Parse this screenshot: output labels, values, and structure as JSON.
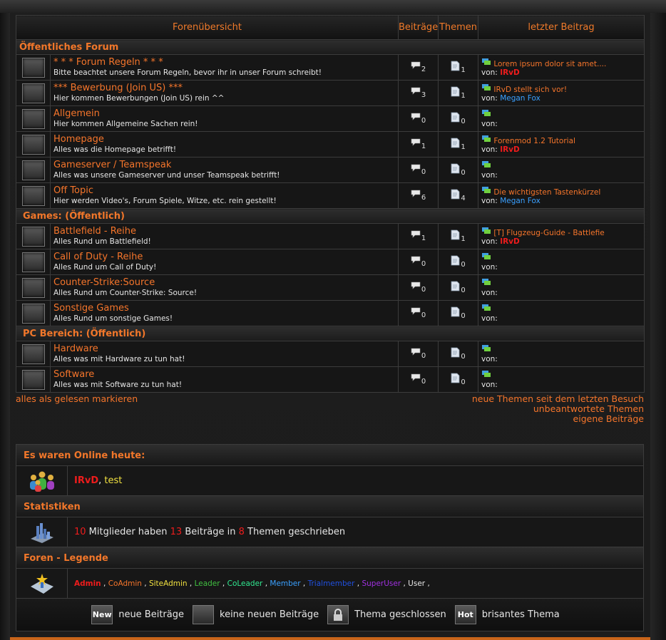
{
  "header": {
    "col_forum": "Forenübersicht",
    "col_posts": "Beiträge",
    "col_topics": "Themen",
    "col_last": "letzter Beitrag"
  },
  "categories": [
    {
      "title": "Öffentliches Forum",
      "forums": [
        {
          "name": "* * * Forum Regeln * * *",
          "desc": "Bitte beachtet unsere Forum Regeln, bevor ihr in unser Forum schreibt!",
          "posts": "2",
          "topics": "1",
          "last_title": "Lorem ipsum dolor sit amet....",
          "von": "von:",
          "last_user": "IRvD",
          "user_color": "red"
        },
        {
          "name": "*** Bewerbung (Join US) ***",
          "desc": "Hier kommen Bewerbungen (Join US) rein ^^",
          "posts": "3",
          "topics": "1",
          "last_title": "IRvD stellt sich vor!",
          "von": "von:",
          "last_user": "Megan Fox",
          "user_color": "blue"
        },
        {
          "name": "Allgemein",
          "desc": "Hier kommen Allgemeine Sachen rein!",
          "posts": "0",
          "topics": "0",
          "last_title": "",
          "von": "von:",
          "last_user": "",
          "user_color": ""
        },
        {
          "name": "Homepage",
          "desc": "Alles was die Homepage betrifft!",
          "posts": "1",
          "topics": "1",
          "last_title": "Forenmod 1.2 Tutorial",
          "von": "von:",
          "last_user": "IRvD",
          "user_color": "red"
        },
        {
          "name": "Gameserver / Teamspeak",
          "desc": "Alles was unsere Gameserver und unser Teamspeak betrifft!",
          "posts": "0",
          "topics": "0",
          "last_title": "",
          "von": "von:",
          "last_user": "",
          "user_color": ""
        },
        {
          "name": "Off Topic",
          "desc": "Hier werden Video's, Forum Spiele, Witze, etc. rein gestellt!",
          "posts": "6",
          "topics": "4",
          "last_title": "Die wichtigsten Tastenkürzel",
          "von": "von:",
          "last_user": "Megan Fox",
          "user_color": "blue"
        }
      ]
    },
    {
      "title": "Games: (Öffentlich)",
      "forums": [
        {
          "name": "Battlefield - Reihe",
          "desc": "Alles Rund um Battlefield!",
          "posts": "1",
          "topics": "1",
          "last_title": "[T] Flugzeug-Guide - Battlefie",
          "von": "von:",
          "last_user": "IRvD",
          "user_color": "red"
        },
        {
          "name": "Call of Duty - Reihe",
          "desc": "Alles Rund um Call of Duty!",
          "posts": "0",
          "topics": "0",
          "last_title": "",
          "von": "von:",
          "last_user": "",
          "user_color": ""
        },
        {
          "name": "Counter-Strike:Source",
          "desc": "Alles Rund um Counter-Strike: Source!",
          "posts": "0",
          "topics": "0",
          "last_title": "",
          "von": "von:",
          "last_user": "",
          "user_color": ""
        },
        {
          "name": "Sonstige Games",
          "desc": "Alles Rund um sonstige Games!",
          "posts": "0",
          "topics": "0",
          "last_title": "",
          "von": "von:",
          "last_user": "",
          "user_color": ""
        }
      ]
    },
    {
      "title": "PC Bereich: (Öffentlich)",
      "forums": [
        {
          "name": "Hardware",
          "desc": "Alles was mit Hardware zu tun hat!",
          "posts": "0",
          "topics": "0",
          "last_title": "",
          "von": "von:",
          "last_user": "",
          "user_color": ""
        },
        {
          "name": "Software",
          "desc": "Alles was mit Software zu tun hat!",
          "posts": "0",
          "topics": "0",
          "last_title": "",
          "von": "von:",
          "last_user": "",
          "user_color": ""
        }
      ]
    }
  ],
  "links": {
    "mark_read": "alles als gelesen markieren",
    "new_topics": "neue Themen seit dem letzten Besuch",
    "unanswered": "unbeantwortete Themen",
    "own_posts": "eigene Beiträge"
  },
  "online": {
    "title": "Es waren Online heute:",
    "user1": "IRvD",
    "sep": ", ",
    "user2": "test"
  },
  "stats": {
    "title": "Statistiken",
    "members": "10",
    "t1": " Mitglieder haben ",
    "posts": "13",
    "t2": " Beiträge in ",
    "topics": "8",
    "t3": " Themen geschrieben"
  },
  "legend": {
    "title": "Foren - Legende",
    "ranks": [
      {
        "name": "Admin",
        "color": "#ee1c1c"
      },
      {
        "name": "CoAdmin",
        "color": "#f5752b"
      },
      {
        "name": "SiteAdmin",
        "color": "#f0e040"
      },
      {
        "name": "Leader",
        "color": "#40c040"
      },
      {
        "name": "CoLeader",
        "color": "#30e890"
      },
      {
        "name": "Member",
        "color": "#3aa0ff"
      },
      {
        "name": "Trialmember",
        "color": "#2050e0"
      },
      {
        "name": "SuperUser",
        "color": "#a030e0"
      },
      {
        "name": "User",
        "color": "#e6e6e6"
      }
    ],
    "rank_sep": " , ",
    "new_icon": "New",
    "new_label": "neue Beiträge",
    "nonew_label": "keine neuen Beiträge",
    "locked_label": "Thema geschlossen",
    "hot_icon": "Hot",
    "hot_label": "brisantes Thema"
  },
  "colors": {
    "accent": "#f5752b",
    "red_user": "#ee1c1c",
    "blue_user": "#3aa0ff"
  },
  "icons": {
    "forum_status": "folder-icon",
    "posts": "speech-bubble-icon",
    "topics": "document-icon",
    "last_post": "chat-bubbles-icon"
  }
}
